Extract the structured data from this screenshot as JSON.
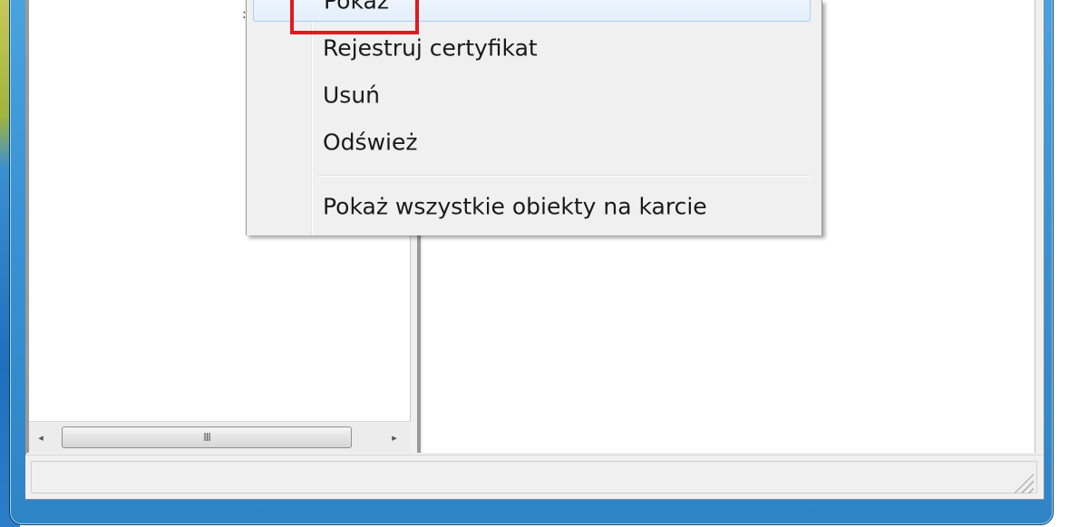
{
  "context_menu": {
    "items": [
      {
        "label": "Pokaż"
      },
      {
        "label": "Rejestruj certyfikat"
      },
      {
        "label": "Usuń"
      },
      {
        "label": "Odśwież"
      },
      {
        "label": "Pokaż wszystkie obiekty na karcie"
      }
    ]
  },
  "scrollbar": {
    "left_arrow": "◂",
    "right_arrow": "▸",
    "thumb_grip": "III"
  },
  "colors": {
    "highlight": "#e3181e",
    "window_frame": "#3a93d4"
  }
}
